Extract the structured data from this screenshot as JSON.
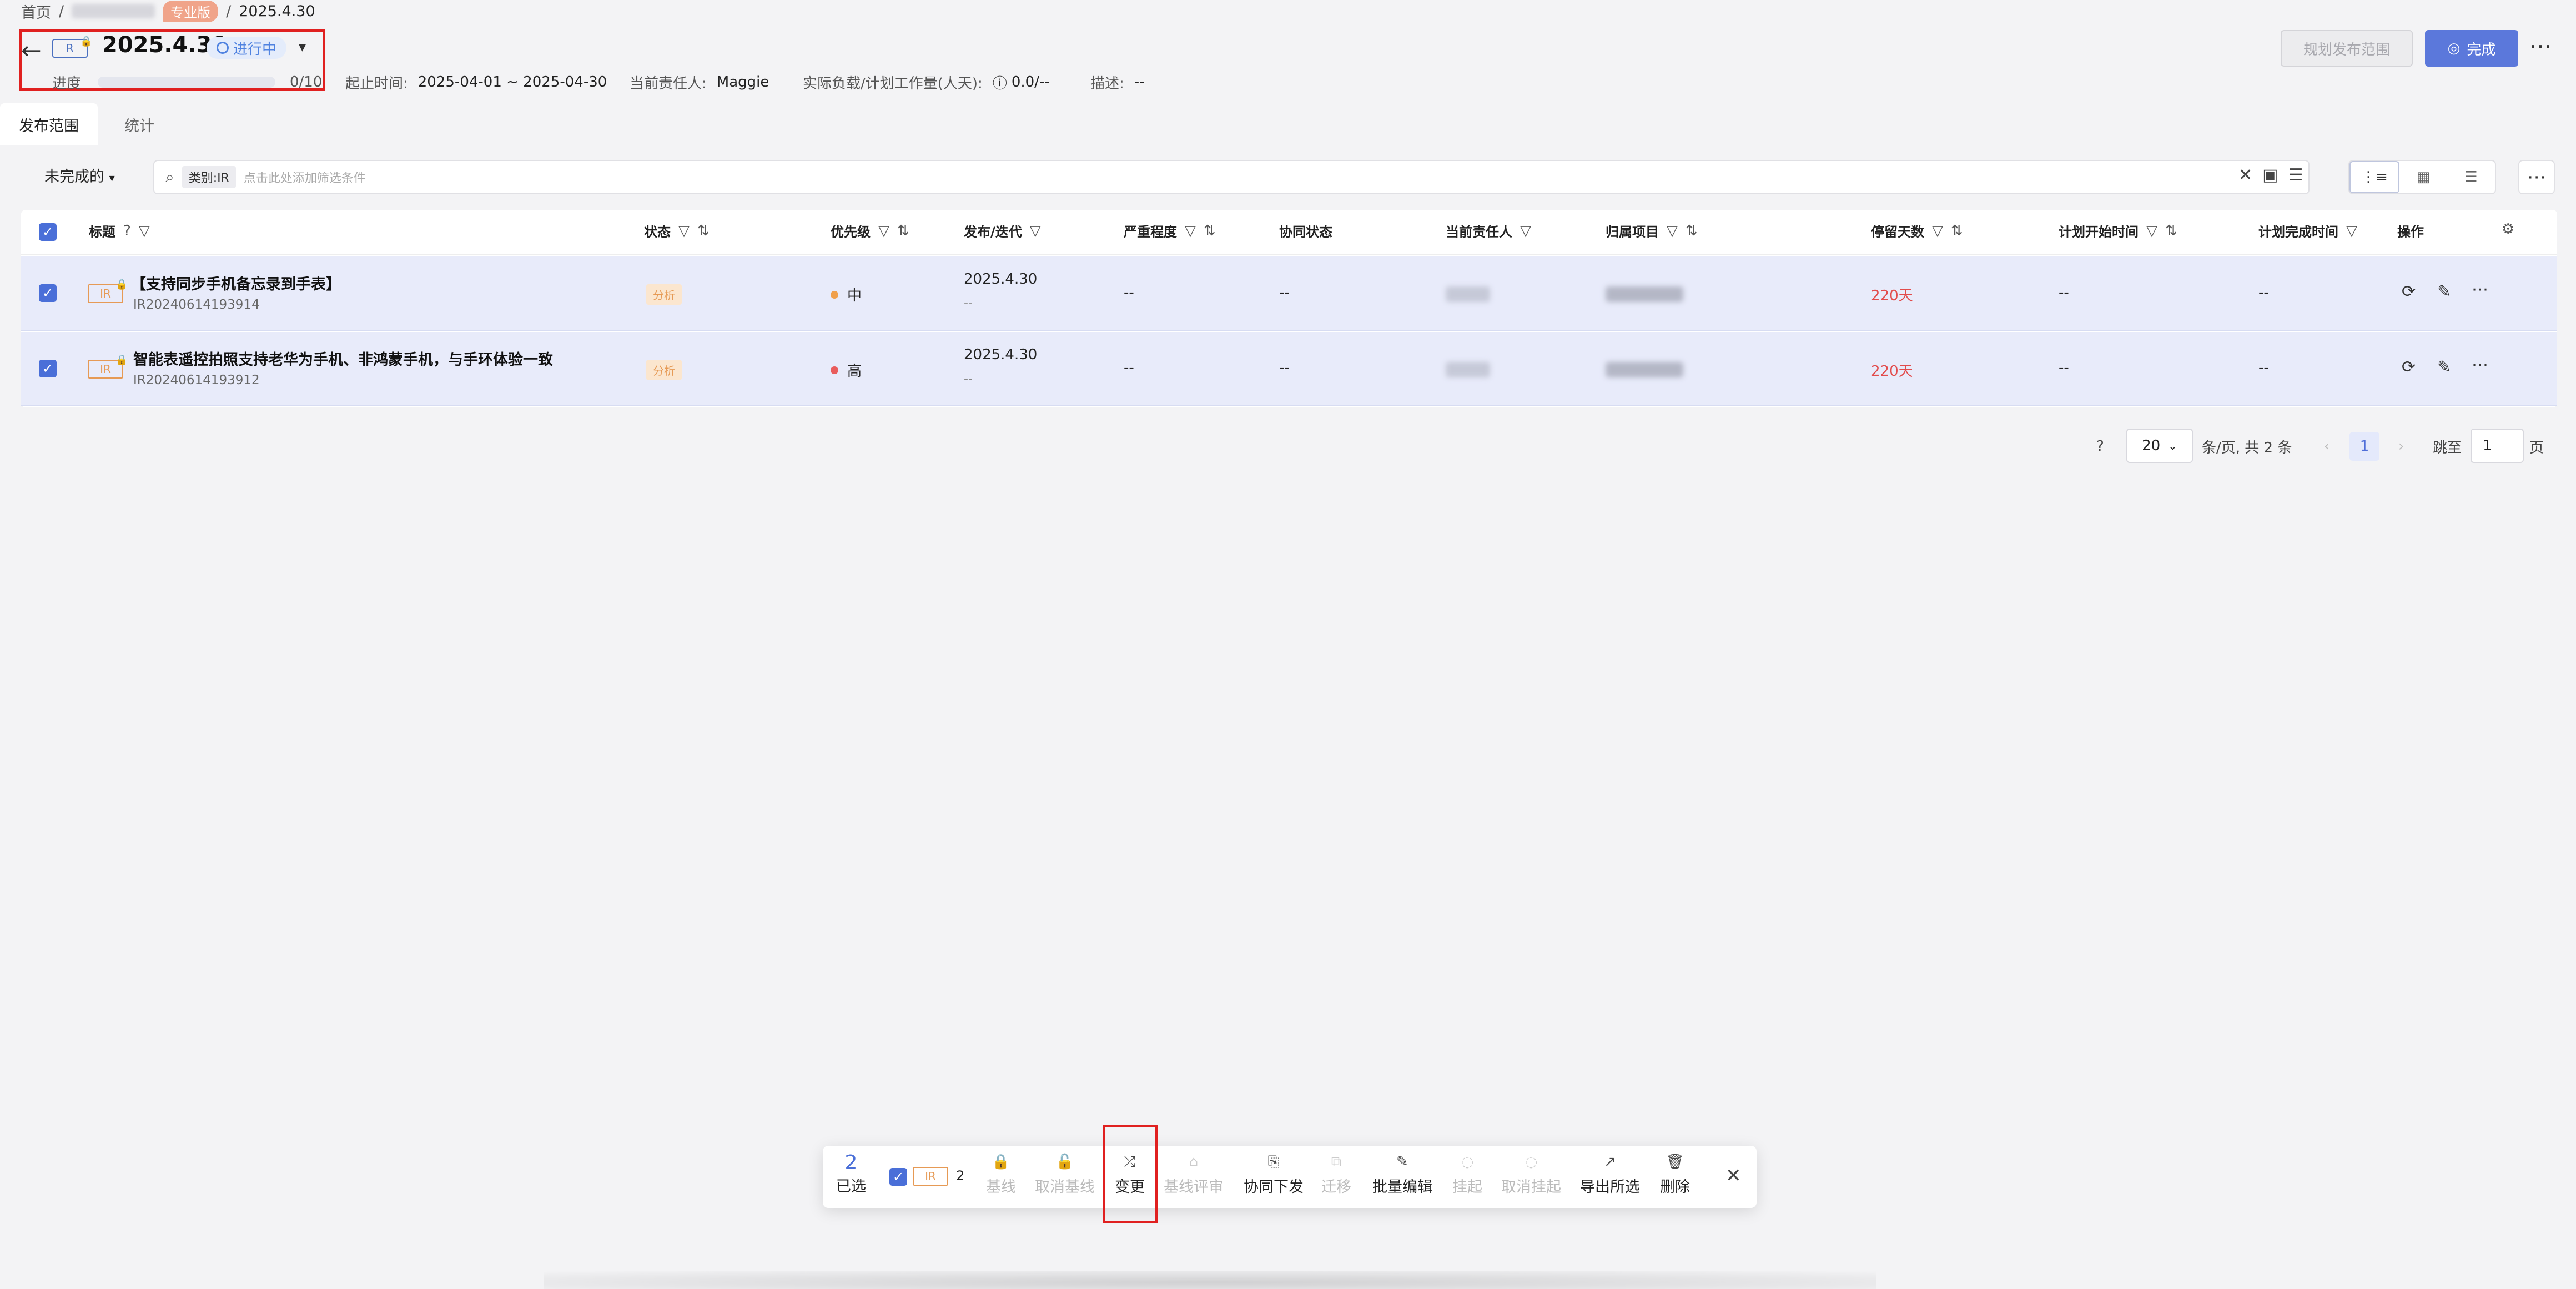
{
  "breadcrumb": {
    "home": "首页",
    "sep": "/",
    "badge": "专业版",
    "current": "2025.4.30"
  },
  "header": {
    "tag": "R",
    "title": "2025.4.30",
    "status": "进行中",
    "progress_label": "进度",
    "progress_value": "0/10",
    "progress_fraction": 0,
    "period_label": "起止时间:",
    "period_value": "2025-04-01 ~ 2025-04-30",
    "owner_label": "当前责任人:",
    "owner_value": "Maggie",
    "load_label": "实际负载/计划工作量(人天):",
    "load_value": "0.0/--",
    "desc_label": "描述:",
    "desc_value": "--",
    "plan_button": "规划发布范围",
    "done_button": "完成",
    "more": "⋯"
  },
  "tabs": [
    {
      "label": "发布范围"
    },
    {
      "label": "统计"
    }
  ],
  "filter": {
    "dropdown": "未完成的",
    "search_tag": "类别:IR",
    "search_placeholder": "点击此处添加筛选条件"
  },
  "table": {
    "headers": {
      "title": "标题",
      "status": "状态",
      "priority": "优先级",
      "release": "发布/迭代",
      "severity": "严重程度",
      "collab": "协同状态",
      "owner": "当前责任人",
      "project": "归属项目",
      "stay": "停留天数",
      "plan_start": "计划开始时间",
      "plan_end": "计划完成时间",
      "ops": "操作"
    },
    "rows": [
      {
        "tag": "IR",
        "title": "【支持同步手机备忘录到手表】",
        "id": "IR20240614193914",
        "status": "分析",
        "priority": "中",
        "priority_color": "#f0a04b",
        "release": "2025.4.30",
        "release_sub": "--",
        "severity": "--",
        "collab": "--",
        "stay": "220天",
        "plan_start": "--",
        "plan_end": "--"
      },
      {
        "tag": "IR",
        "title": "智能表遥控拍照支持老华为手机、非鸿蒙手机，与手环体验一致",
        "id": "IR20240614193912",
        "status": "分析",
        "priority": "高",
        "priority_color": "#e95c5c",
        "release": "2025.4.30",
        "release_sub": "--",
        "severity": "--",
        "collab": "--",
        "stay": "220天",
        "plan_start": "--",
        "plan_end": "--"
      }
    ]
  },
  "pager": {
    "page_size": "20",
    "per_page_text": "条/页, 共 2 条",
    "current": "1",
    "jump_label": "跳至",
    "jump_value": "1",
    "page_unit": "页"
  },
  "actionbar": {
    "count": "2",
    "selected_label": "已选",
    "type_tag": "IR",
    "type_count": "2",
    "items": [
      {
        "label": "基线",
        "enabled": false
      },
      {
        "label": "取消基线",
        "enabled": false
      },
      {
        "label": "变更",
        "enabled": true
      },
      {
        "label": "基线评审",
        "enabled": false
      },
      {
        "label": "协同下发",
        "enabled": true
      },
      {
        "label": "迁移",
        "enabled": false
      },
      {
        "label": "批量编辑",
        "enabled": true
      },
      {
        "label": "挂起",
        "enabled": false
      },
      {
        "label": "取消挂起",
        "enabled": false
      },
      {
        "label": "导出所选",
        "enabled": true
      },
      {
        "label": "删除",
        "enabled": true
      }
    ]
  },
  "colors": {
    "accent": "#5b78db",
    "highlight": "#e02020",
    "warning": "#e69a55",
    "danger": "#e24c4c"
  }
}
